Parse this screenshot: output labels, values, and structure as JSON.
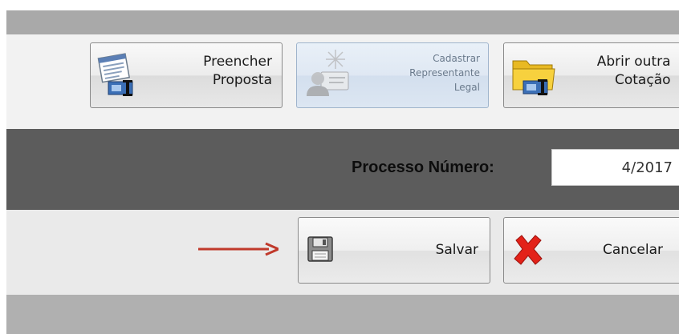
{
  "toolbar": {
    "preencher": {
      "line1": "Preencher",
      "line2": "Proposta",
      "icon": "form-edit-icon"
    },
    "cadastrar": {
      "line1": "Cadastrar",
      "line2": "Representante",
      "line3": "Legal",
      "icon": "add-representative-icon",
      "state": "disabled"
    },
    "abrir": {
      "line1": "Abrir outra",
      "line2": "Cotação",
      "icon": "open-folder-icon"
    }
  },
  "process": {
    "label": "Processo Número:",
    "value": "4/2017"
  },
  "actions": {
    "save_label": "Salvar",
    "save_icon": "floppy-disk-icon",
    "cancel_label": "Cancelar",
    "cancel_icon": "red-x-icon"
  },
  "annotation": {
    "arrow_color": "#c0392b"
  },
  "colors": {
    "top_band": "#a9a9a9",
    "toolbar_band": "#f2f2f2",
    "process_band": "#5c5c5c",
    "actions_band": "#eaeaea",
    "bottom_band": "#b0b0b0"
  }
}
